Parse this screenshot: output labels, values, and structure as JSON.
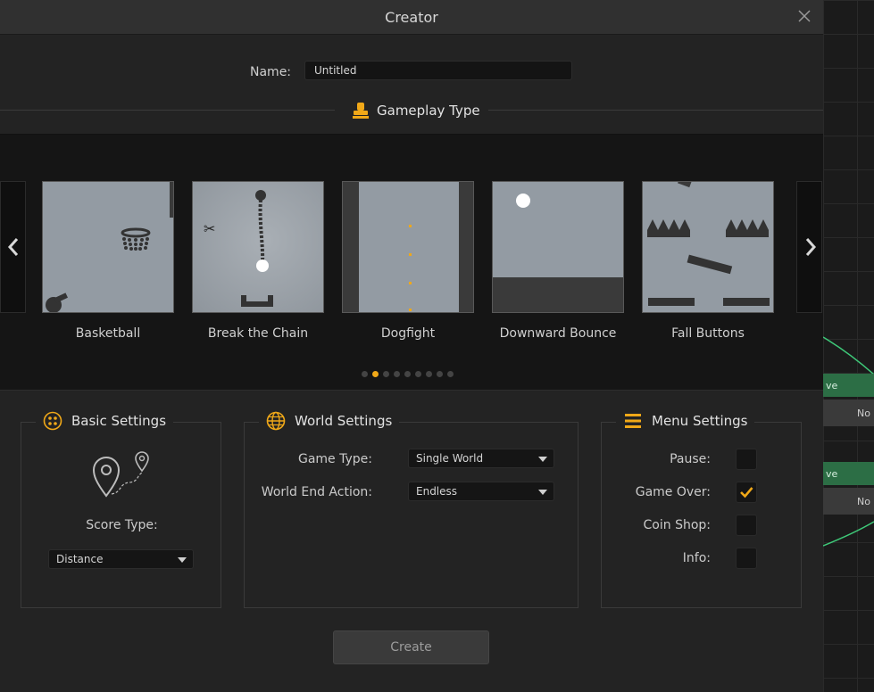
{
  "dialog": {
    "title": "Creator",
    "name_label": "Name:",
    "name_value": "Untitled",
    "gameplay_title": "Gameplay Type",
    "create_label": "Create"
  },
  "carousel": {
    "cards": [
      {
        "label": "Basketball"
      },
      {
        "label": "Break the  Chain"
      },
      {
        "label": "Dogfight"
      },
      {
        "label": "Downward  Bounce"
      },
      {
        "label": "Fall  Buttons"
      }
    ],
    "page_count": 9,
    "active_page": 2
  },
  "basic_settings": {
    "title": "Basic Settings",
    "score_type_label": "Score Type:",
    "score_type_value": "Distance"
  },
  "world_settings": {
    "title": "World Settings",
    "game_type_label": "Game Type:",
    "game_type_value": "Single World",
    "end_action_label": "World End Action:",
    "end_action_value": "Endless"
  },
  "menu_settings": {
    "title": "Menu Settings",
    "items": [
      {
        "label": "Pause:",
        "checked": false
      },
      {
        "label": "Game Over:",
        "checked": true
      },
      {
        "label": "Coin Shop:",
        "checked": false
      },
      {
        "label": "Info:",
        "checked": false
      }
    ]
  },
  "background_editor": {
    "node_labels": [
      "ve",
      "No",
      "ve",
      "No"
    ]
  },
  "colors": {
    "accent": "#f0a818",
    "node_green": "#2c6e45",
    "dialog_bg": "#232323"
  }
}
